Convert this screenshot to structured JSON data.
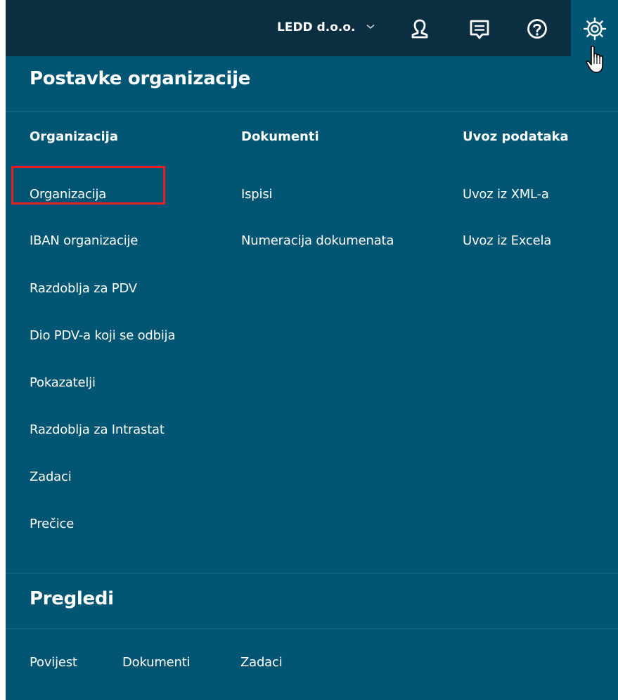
{
  "header": {
    "company": "LEDD d.o.o.",
    "icons": {
      "dropdown": "chevron-down-icon",
      "user": "user-icon",
      "messages": "chat-icon",
      "help": "help-icon",
      "settings": "gear-icon",
      "pointer": "hand-pointer-icon"
    }
  },
  "settings": {
    "title": "Postavke organizacije",
    "columns": [
      {
        "heading": "Organizacija",
        "items": [
          "Organizacija",
          "IBAN organizacije",
          "Razdoblja za PDV",
          "Dio PDV-a koji se odbija",
          "Pokazatelji",
          "Razdoblja za Intrastat",
          "Zadaci",
          "Prečice"
        ]
      },
      {
        "heading": "Dokumenti",
        "items": [
          "Ispisi",
          "Numeracija dokumenata"
        ]
      },
      {
        "heading": "Uvoz podataka",
        "items": [
          "Uvoz iz XML-a",
          "Uvoz iz Excela"
        ]
      }
    ],
    "highlighted_item": "IBAN organizacije"
  },
  "reviews": {
    "title": "Pregledi",
    "items": [
      "Povijest",
      "Dokumenti",
      "Zadaci"
    ]
  },
  "colors": {
    "topbar": "#0b2e40",
    "panel": "#025673",
    "divider": "#18698a",
    "text": "#ffffff",
    "highlight": "#e81c24"
  }
}
